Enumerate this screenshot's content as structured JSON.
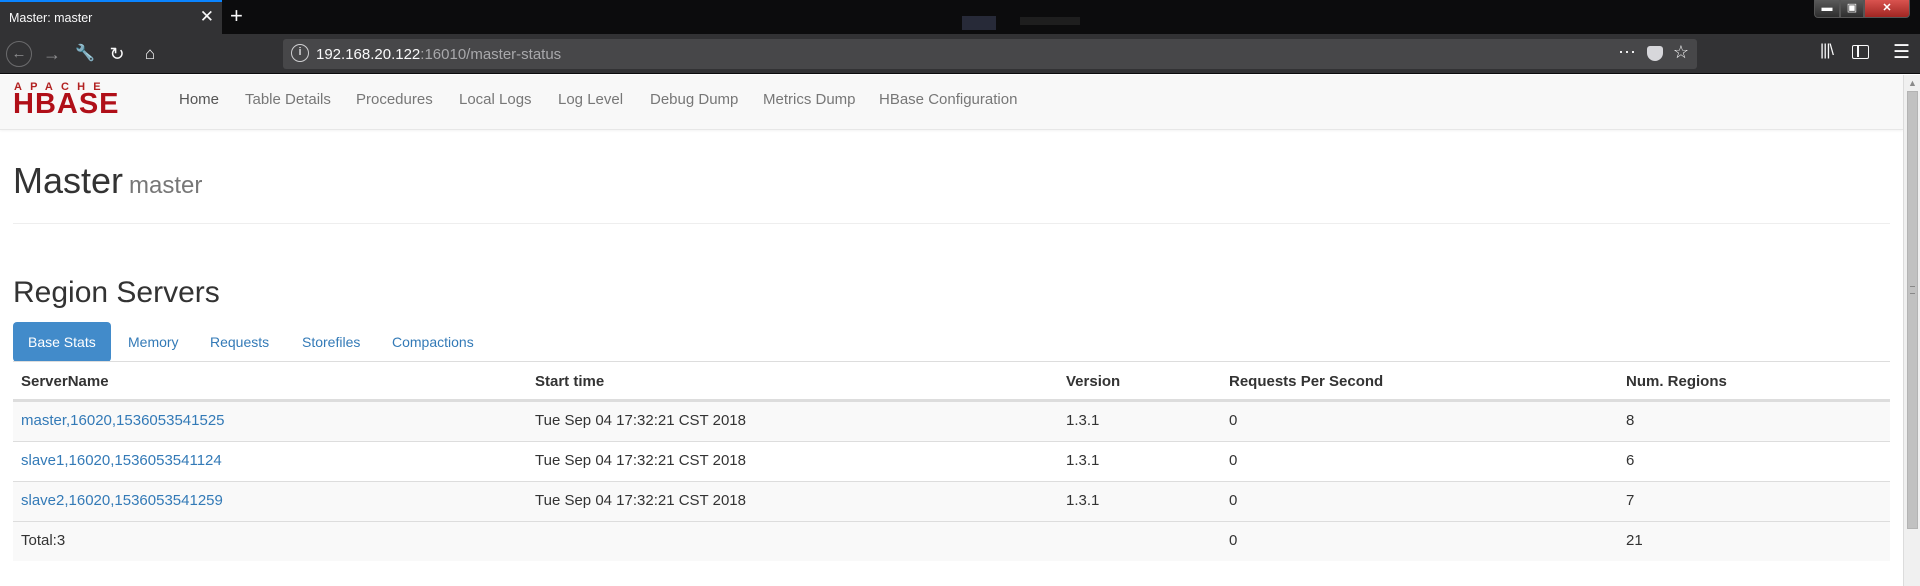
{
  "browser": {
    "tab_title": "Master: master",
    "tab_close": "✕",
    "new_tab": "+",
    "url_host": "192.168.20.122",
    "url_path": ":16010/master-status",
    "window_controls": {
      "minimize": "▬",
      "maximize": "▣",
      "close": "✕"
    },
    "icons": [
      "back-icon",
      "forward-icon",
      "wrench-icon",
      "reload-icon",
      "home-icon",
      "info-icon",
      "more-icon",
      "pocket-icon",
      "star-icon",
      "library-icon",
      "sidebar-icon",
      "menu-icon"
    ]
  },
  "navbar": {
    "logo_apache": "APACHE",
    "logo_hbase": "HBASE",
    "items": [
      {
        "label": "Home",
        "active": true
      },
      {
        "label": "Table Details"
      },
      {
        "label": "Procedures"
      },
      {
        "label": "Local Logs"
      },
      {
        "label": "Log Level"
      },
      {
        "label": "Debug Dump"
      },
      {
        "label": "Metrics Dump"
      },
      {
        "label": "HBase Configuration"
      }
    ]
  },
  "header": {
    "title": "Master",
    "subtitle": "master"
  },
  "region_servers": {
    "title": "Region Servers",
    "tabs": [
      {
        "label": "Base Stats",
        "active": true
      },
      {
        "label": "Memory"
      },
      {
        "label": "Requests"
      },
      {
        "label": "Storefiles"
      },
      {
        "label": "Compactions"
      }
    ],
    "columns": [
      "ServerName",
      "Start time",
      "Version",
      "Requests Per Second",
      "Num. Regions"
    ],
    "rows": [
      {
        "server": "master,16020,1536053541525",
        "start": "Tue Sep 04 17:32:21 CST 2018",
        "version": "1.3.1",
        "rps": "0",
        "regions": "8"
      },
      {
        "server": "slave1,16020,1536053541124",
        "start": "Tue Sep 04 17:32:21 CST 2018",
        "version": "1.3.1",
        "rps": "0",
        "regions": "6"
      },
      {
        "server": "slave2,16020,1536053541259",
        "start": "Tue Sep 04 17:32:21 CST 2018",
        "version": "1.3.1",
        "rps": "0",
        "regions": "7"
      }
    ],
    "total": {
      "label": "Total:3",
      "rps": "0",
      "regions": "21"
    }
  },
  "colors": {
    "link": "#337ab7",
    "active_pill": "#428bca",
    "hbase_red": "#b00f18",
    "firefox_accent": "#0a84ff"
  }
}
